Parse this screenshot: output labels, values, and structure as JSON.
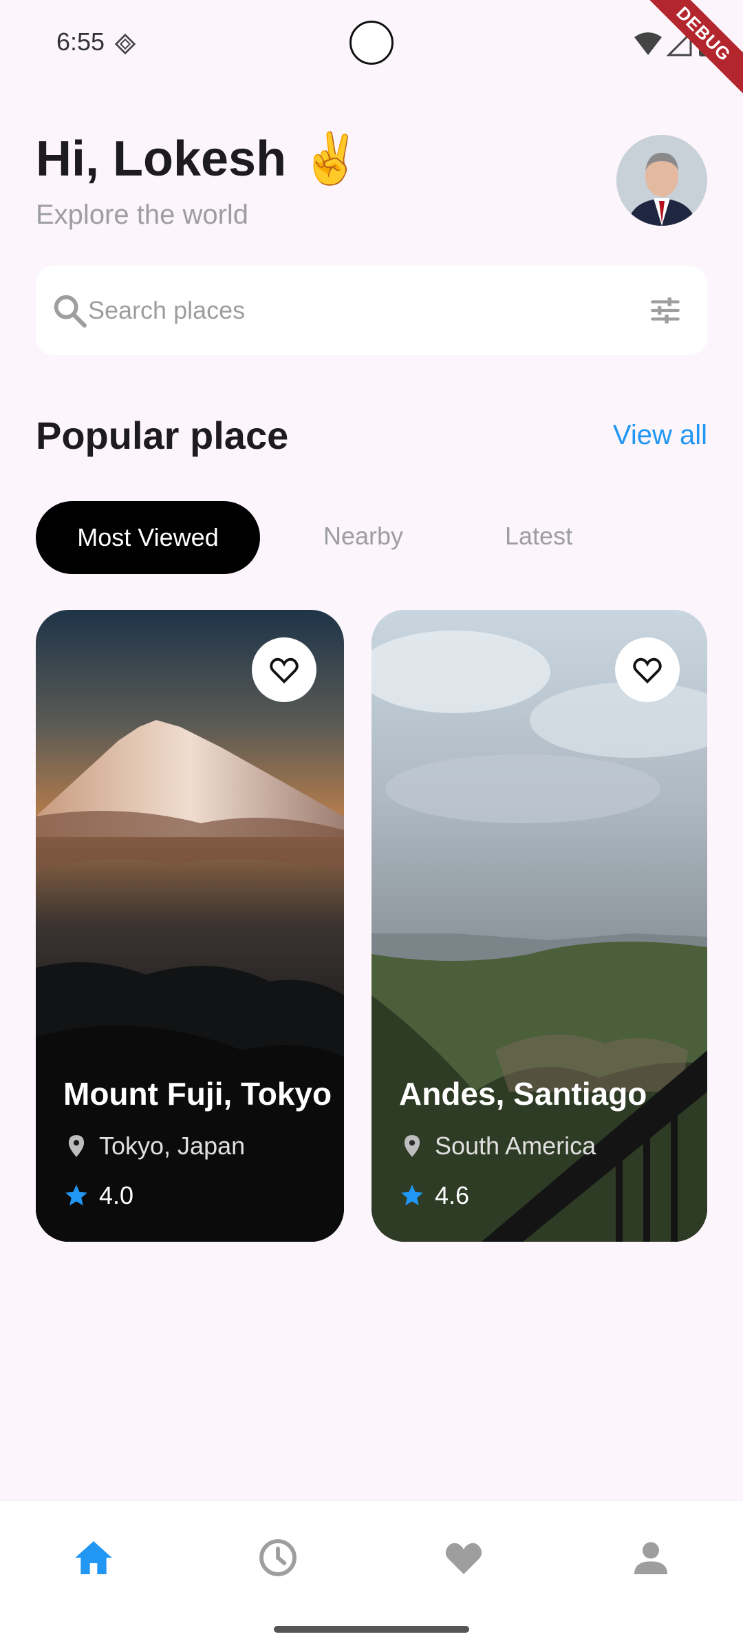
{
  "status_bar": {
    "time": "6:55",
    "debug_label": "DEBUG"
  },
  "header": {
    "greeting": "Hi, Lokesh ✌️",
    "subtitle": "Explore the world"
  },
  "search": {
    "placeholder": "Search places",
    "value": ""
  },
  "section": {
    "title": "Popular place",
    "view_all_label": "View all"
  },
  "tabs": [
    {
      "label": "Most Viewed",
      "active": true
    },
    {
      "label": "Nearby",
      "active": false
    },
    {
      "label": "Latest",
      "active": false
    }
  ],
  "places": [
    {
      "title": "Mount Fuji, Tokyo",
      "location": "Tokyo, Japan",
      "rating": "4.0"
    },
    {
      "title": "Andes, Santiago",
      "location": "South America",
      "rating": "4.6"
    }
  ],
  "bottom_nav": [
    {
      "icon": "home-icon",
      "active": true
    },
    {
      "icon": "history-icon",
      "active": false
    },
    {
      "icon": "heart-icon",
      "active": false
    },
    {
      "icon": "profile-icon",
      "active": false
    }
  ],
  "colors": {
    "accent": "#2196f3",
    "background": "#fcf5fb",
    "inactive": "#9e9e9e"
  }
}
